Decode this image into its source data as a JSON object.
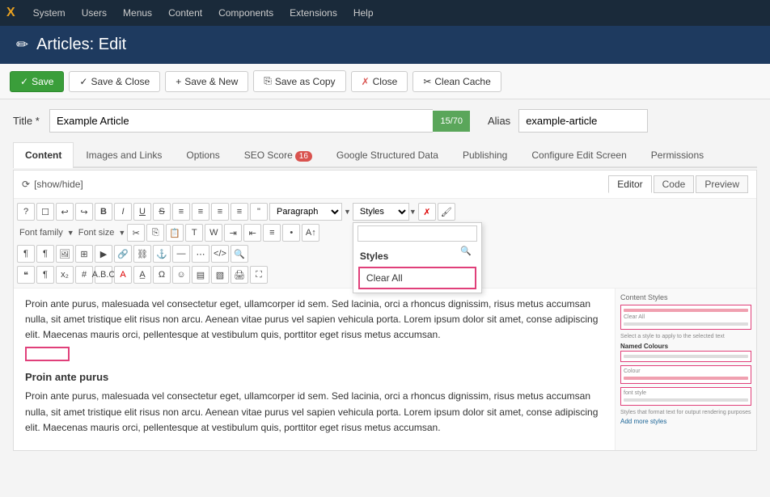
{
  "top_menu": {
    "logo": "X",
    "items": [
      "System",
      "Users",
      "Menus",
      "Content",
      "Components",
      "Extensions",
      "Help"
    ]
  },
  "page_header": {
    "icon": "✏",
    "title": "Articles: Edit"
  },
  "toolbar": {
    "buttons": [
      {
        "id": "save",
        "label": "Save",
        "icon": "✓",
        "style": "green"
      },
      {
        "id": "save-close",
        "label": "Save & Close",
        "icon": "✓",
        "style": "normal"
      },
      {
        "id": "save-new",
        "label": "Save & New",
        "icon": "+",
        "style": "normal"
      },
      {
        "id": "save-copy",
        "label": "Save as Copy",
        "icon": "⎘",
        "style": "normal"
      },
      {
        "id": "close",
        "label": "Close",
        "icon": "✗",
        "style": "normal"
      },
      {
        "id": "clean-cache",
        "label": "Clean Cache",
        "icon": "✂",
        "style": "normal"
      }
    ]
  },
  "title_row": {
    "label": "Title *",
    "value": "Example Article",
    "counter": "15/70",
    "alias_label": "Alias",
    "alias_value": "example-article"
  },
  "tabs": [
    {
      "id": "content",
      "label": "Content",
      "active": true,
      "badge": null
    },
    {
      "id": "images-links",
      "label": "Images and Links",
      "active": false,
      "badge": null
    },
    {
      "id": "options",
      "label": "Options",
      "active": false,
      "badge": null
    },
    {
      "id": "seo-score",
      "label": "SEO Score",
      "active": false,
      "badge": "16"
    },
    {
      "id": "google-structured-data",
      "label": "Google Structured Data",
      "active": false,
      "badge": null
    },
    {
      "id": "publishing",
      "label": "Publishing",
      "active": false,
      "badge": null
    },
    {
      "id": "configure-edit-screen",
      "label": "Configure Edit Screen",
      "active": false,
      "badge": null
    },
    {
      "id": "permissions",
      "label": "Permissions",
      "active": false,
      "badge": null
    }
  ],
  "editor": {
    "show_hide_label": "[show/hide]",
    "view_tabs": [
      "Editor",
      "Code",
      "Preview"
    ],
    "active_view": "Editor",
    "toolbar": {
      "row1_items": [
        "?",
        "☐",
        "↩",
        "↪",
        "B",
        "I",
        "U",
        "S",
        "≡",
        "≡",
        "≡",
        "≡",
        "\""
      ],
      "paragraph_select": "Paragraph",
      "styles_select": "Styles"
    },
    "font_family_label": "Font family",
    "font_size_label": "Font size",
    "styles_dropdown": {
      "search_placeholder": "",
      "title": "Styles",
      "clear_all_label": "Clear All"
    }
  },
  "editor_content": {
    "body_text": "Proin ante purus, malesuada vel consectetur eget, ullamcorper id sem. Sed lacinia, orci a rhoncus dignissim, risus metus accumsan nulla, sit amet tristique elit risus non arcu. Aenean vitae purus vel sapien vehicula porta. Lorem ipsum dolor sit amet, conse adipiscing elit. Maecenas mauris orci, pellentesque at vestibulum quis, porttitor eget risus metus accumsan.",
    "heading": "Proin ante purus",
    "body_text2": "Proin ante purus, malesuada vel consectetur eget, ullamcorper id sem. Sed lacinia, orci a rhoncus dignissim, risus metus accumsan nulla, sit amet tristique elit risus non arcu. Aenean vitae purus vel sapien vehicula porta. Lorem ipsum dolor sit amet, conse adipiscing elit. Maecenas mauris orci, pellentesque at vestibulum quis, porttitor eget risus metus accumsan."
  },
  "colors": {
    "green": "#3a9e3a",
    "red_badge": "#d9534f",
    "pink": "#e0407a",
    "header_bg": "#1e3a5f",
    "menu_bg": "#1a2a3a"
  }
}
